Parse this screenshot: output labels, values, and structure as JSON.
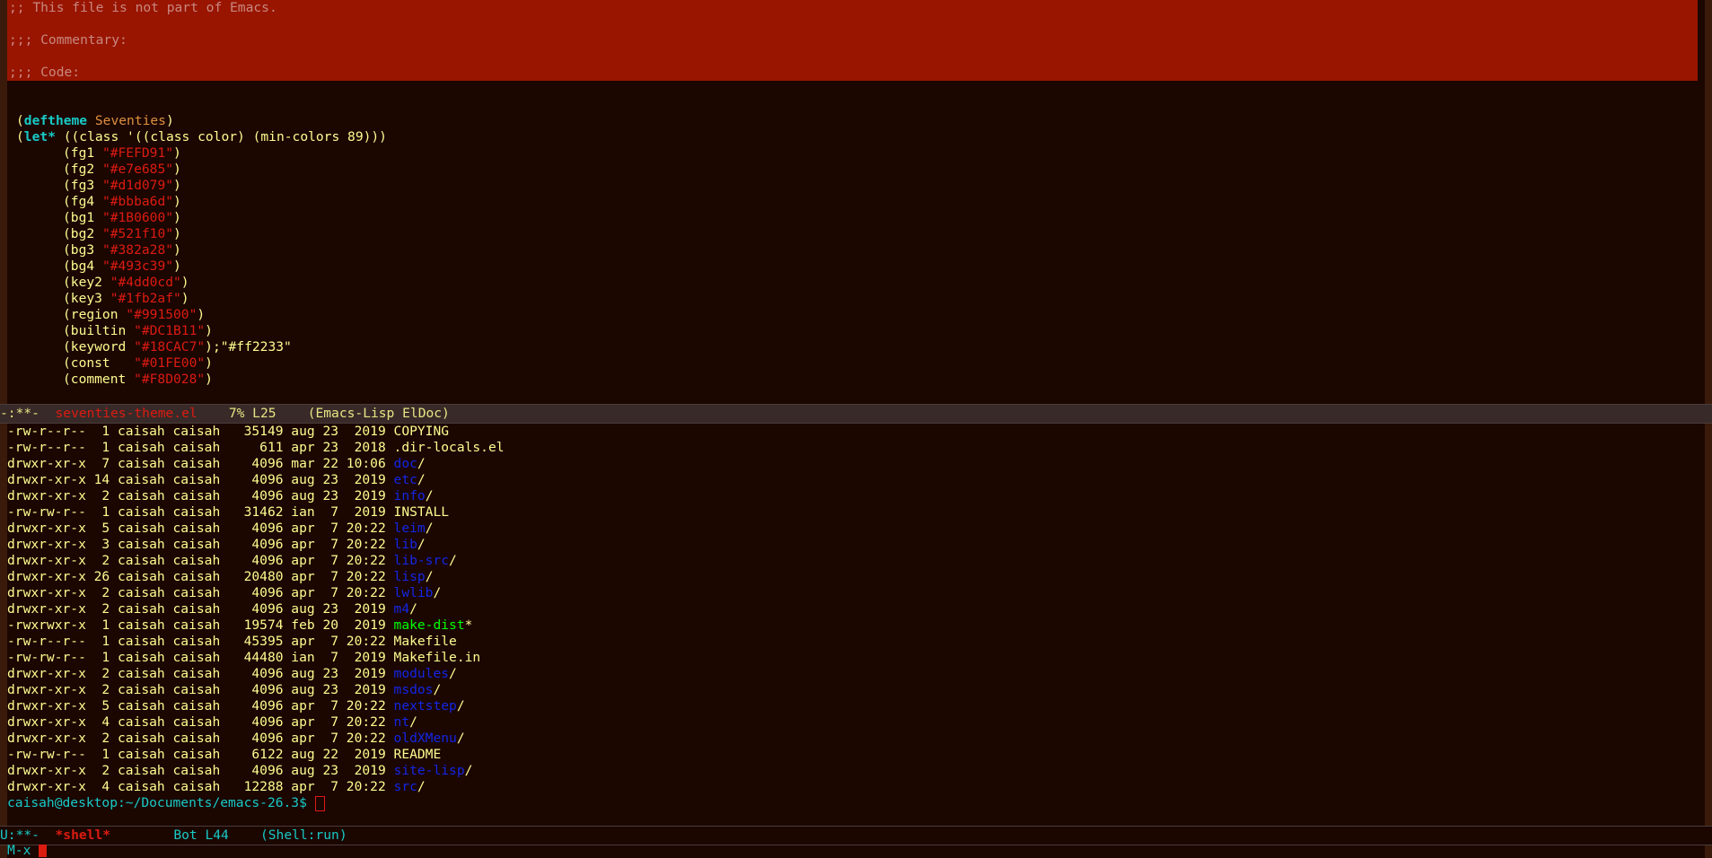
{
  "code": {
    "region_lines": [
      ";; This file is not part of Emacs.",
      "",
      ";;; Commentary:",
      "",
      ";;; Code:"
    ],
    "deftheme_line": {
      "open": "(",
      "kw": "deftheme",
      "name": "Seventies",
      "close": ")"
    },
    "let_line": {
      "open": "(",
      "kw": "let*",
      "rest": " ((class '((class color) (min-colors 89)))"
    },
    "bindings": [
      {
        "name": "(fg1 ",
        "value": "\"#FEFD91\"",
        "tail": ")"
      },
      {
        "name": "(fg2 ",
        "value": "\"#e7e685\"",
        "tail": ")"
      },
      {
        "name": "(fg3 ",
        "value": "\"#d1d079\"",
        "tail": ")"
      },
      {
        "name": "(fg4 ",
        "value": "\"#bbba6d\"",
        "tail": ")"
      },
      {
        "name": "(bg1 ",
        "value": "\"#1B0600\"",
        "tail": ")"
      },
      {
        "name": "(bg2 ",
        "value": "\"#521f10\"",
        "tail": ")"
      },
      {
        "name": "(bg3 ",
        "value": "\"#382a28\"",
        "tail": ")"
      },
      {
        "name": "(bg4 ",
        "value": "\"#493c39\"",
        "tail": ")"
      },
      {
        "name": "(key2 ",
        "value": "\"#4dd0cd\"",
        "tail": ")"
      },
      {
        "name": "(key3 ",
        "value": "\"#1fb2af\"",
        "tail": ")"
      },
      {
        "name": "(region ",
        "value": "\"#991500\"",
        "tail": ")"
      },
      {
        "name": "(builtin ",
        "value": "\"#DC1B11\"",
        "tail": ")"
      },
      {
        "name": "(keyword ",
        "value": "\"#18CAC7\"",
        "tail": ");\"#ff2233\""
      },
      {
        "name": "(const   ",
        "value": "\"#01FE00\"",
        "tail": ")"
      },
      {
        "name": "(comment ",
        "value": "\"#F8D028\"",
        "tail": ")"
      }
    ]
  },
  "mode_line_top": {
    "status": "-:**-  ",
    "buffer": "seventies-theme.el",
    "position": "    7% L25    ",
    "modes": "(Emacs-Lisp ElDoc)"
  },
  "shell": {
    "listing": [
      {
        "meta": "-rw-r--r--  1 caisah caisah   35149 aug 23  2019 ",
        "name": "COPYING",
        "kind": "file",
        "suffix": ""
      },
      {
        "meta": "-rw-r--r--  1 caisah caisah     611 apr 23  2018 ",
        "name": ".dir-locals.el",
        "kind": "file",
        "suffix": ""
      },
      {
        "meta": "drwxr-xr-x  7 caisah caisah    4096 mar 22 10:06 ",
        "name": "doc",
        "kind": "dir",
        "suffix": "/"
      },
      {
        "meta": "drwxr-xr-x 14 caisah caisah    4096 aug 23  2019 ",
        "name": "etc",
        "kind": "dir",
        "suffix": "/"
      },
      {
        "meta": "drwxr-xr-x  2 caisah caisah    4096 aug 23  2019 ",
        "name": "info",
        "kind": "dir",
        "suffix": "/"
      },
      {
        "meta": "-rw-rw-r--  1 caisah caisah   31462 ian  7  2019 ",
        "name": "INSTALL",
        "kind": "file",
        "suffix": ""
      },
      {
        "meta": "drwxr-xr-x  5 caisah caisah    4096 apr  7 20:22 ",
        "name": "leim",
        "kind": "dir",
        "suffix": "/"
      },
      {
        "meta": "drwxr-xr-x  3 caisah caisah    4096 apr  7 20:22 ",
        "name": "lib",
        "kind": "dir",
        "suffix": "/"
      },
      {
        "meta": "drwxr-xr-x  2 caisah caisah    4096 apr  7 20:22 ",
        "name": "lib-src",
        "kind": "dir",
        "suffix": "/"
      },
      {
        "meta": "drwxr-xr-x 26 caisah caisah   20480 apr  7 20:22 ",
        "name": "lisp",
        "kind": "dir",
        "suffix": "/"
      },
      {
        "meta": "drwxr-xr-x  2 caisah caisah    4096 apr  7 20:22 ",
        "name": "lwlib",
        "kind": "dir",
        "suffix": "/"
      },
      {
        "meta": "drwxr-xr-x  2 caisah caisah    4096 aug 23  2019 ",
        "name": "m4",
        "kind": "dir",
        "suffix": "/"
      },
      {
        "meta": "-rwxrwxr-x  1 caisah caisah   19574 feb 20  2019 ",
        "name": "make-dist",
        "kind": "exe",
        "suffix": "*"
      },
      {
        "meta": "-rw-r--r--  1 caisah caisah   45395 apr  7 20:22 ",
        "name": "Makefile",
        "kind": "file",
        "suffix": ""
      },
      {
        "meta": "-rw-rw-r--  1 caisah caisah   44480 ian  7  2019 ",
        "name": "Makefile.in",
        "kind": "file",
        "suffix": ""
      },
      {
        "meta": "drwxr-xr-x  2 caisah caisah    4096 aug 23  2019 ",
        "name": "modules",
        "kind": "dir",
        "suffix": "/"
      },
      {
        "meta": "drwxr-xr-x  2 caisah caisah    4096 aug 23  2019 ",
        "name": "msdos",
        "kind": "dir",
        "suffix": "/"
      },
      {
        "meta": "drwxr-xr-x  5 caisah caisah    4096 apr  7 20:22 ",
        "name": "nextstep",
        "kind": "dir",
        "suffix": "/"
      },
      {
        "meta": "drwxr-xr-x  4 caisah caisah    4096 apr  7 20:22 ",
        "name": "nt",
        "kind": "dir",
        "suffix": "/"
      },
      {
        "meta": "drwxr-xr-x  2 caisah caisah    4096 apr  7 20:22 ",
        "name": "oldXMenu",
        "kind": "dir",
        "suffix": "/"
      },
      {
        "meta": "-rw-rw-r--  1 caisah caisah    6122 aug 22  2019 ",
        "name": "README",
        "kind": "file",
        "suffix": ""
      },
      {
        "meta": "drwxr-xr-x  2 caisah caisah    4096 aug 23  2019 ",
        "name": "site-lisp",
        "kind": "dir",
        "suffix": "/"
      },
      {
        "meta": "drwxr-xr-x  4 caisah caisah   12288 apr  7 20:22 ",
        "name": "src",
        "kind": "dir",
        "suffix": "/"
      }
    ],
    "prompt": "caisah@desktop:~/Documents/emacs-26.3$ "
  },
  "mode_line_bottom": {
    "status": "U:**-  ",
    "buffer": "*shell*",
    "position": "        Bot L44    ",
    "modes": "(Shell:run)"
  },
  "minibuffer": {
    "text": "M-x "
  },
  "colors": {
    "fg1": "#FEFD91",
    "bg1": "#1B0600",
    "region": "#991500",
    "keyword": "#18CAC7",
    "builtin": "#DC1B11",
    "const": "#01FE00",
    "dir": "#1426E6"
  }
}
